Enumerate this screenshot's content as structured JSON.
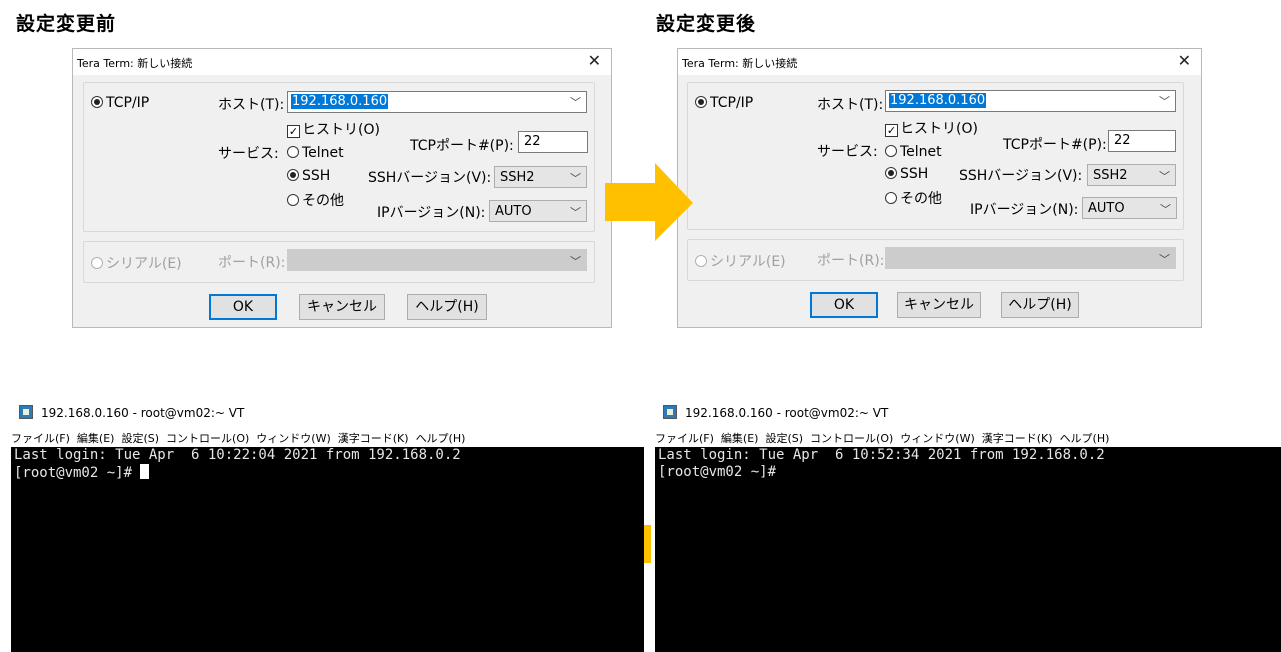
{
  "headings": {
    "before": "設定変更前",
    "after": "設定変更後"
  },
  "colors": {
    "arrow": "#ffc000",
    "selection": "#0078d7",
    "terminal_bg": "#000000"
  },
  "dialog": {
    "title": "Tera Term: 新しい接続",
    "tcpip_label": "TCP/IP",
    "host_label": "ホスト(T):",
    "host_value": "192.168.0.160",
    "history_label": "ヒストリ(O)",
    "service_label": "サービス:",
    "telnet_label": "Telnet",
    "ssh_label": "SSH",
    "other_label": "その他",
    "tcpport_label": "TCPポート#(P):",
    "tcpport_value": "22",
    "sshver_label": "SSHバージョン(V):",
    "sshver_value": "SSH2",
    "ipver_label": "IPバージョン(N):",
    "ipver_value": "AUTO",
    "serial_label": "シリアル(E)",
    "port_label": "ポート(R):",
    "ok_label": "OK",
    "cancel_label": "キャンセル",
    "help_label": "ヘルプ(H)"
  },
  "terminal": {
    "title": "192.168.0.160 - root@vm02:~ VT",
    "menu": [
      "ファイル(F)",
      "編集(E)",
      "設定(S)",
      "コントロール(O)",
      "ウィンドウ(W)",
      "漢字コード(K)",
      "ヘルプ(H)"
    ],
    "before": {
      "line1": "Last login: Tue Apr  6 10:22:04 2021 from 192.168.0.2",
      "line2": "[root@vm02 ~]# "
    },
    "after": {
      "line1": "Last login: Tue Apr  6 10:52:34 2021 from 192.168.0.2",
      "line2": "[root@vm02 ~]#"
    }
  }
}
